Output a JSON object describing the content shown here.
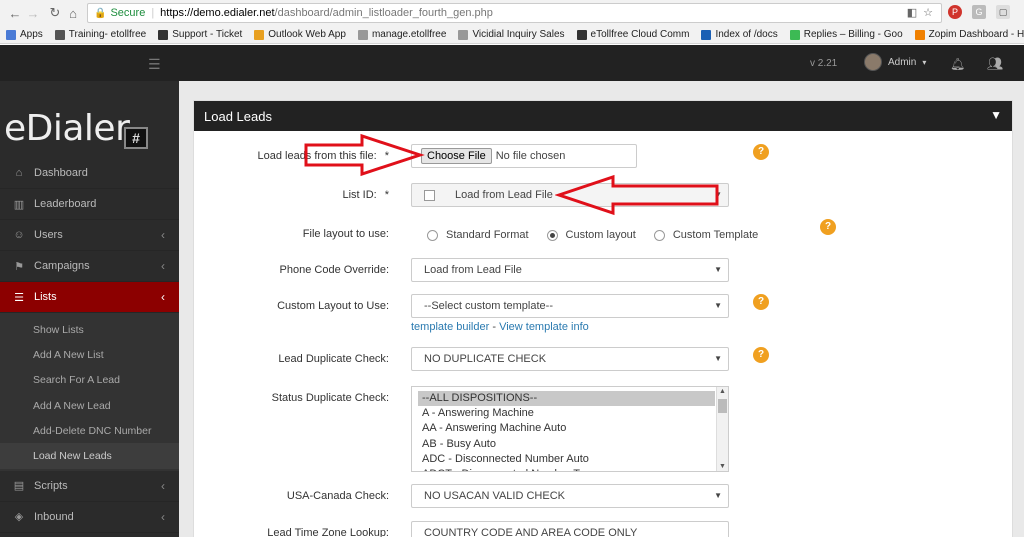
{
  "browser": {
    "secure_label": "Secure",
    "url_host": "https://demo.edialer.net",
    "url_path": "/dashboard/admin_listloader_fourth_gen.php",
    "bookmarks": [
      {
        "label": "Apps",
        "color": "#4a7bd6"
      },
      {
        "label": "Training- etollfree",
        "color": "#555555"
      },
      {
        "label": "Support - Ticket",
        "color": "#333333"
      },
      {
        "label": "Outlook Web App",
        "color": "#e8a020"
      },
      {
        "label": "manage.etollfree",
        "color": "#999999"
      },
      {
        "label": "Vicidial Inquiry Sales",
        "color": "#999999"
      },
      {
        "label": "eTollfree Cloud Comm",
        "color": "#333333"
      },
      {
        "label": "Index of /docs",
        "color": "#1a5fb4"
      },
      {
        "label": "Replies – Billing - Goo",
        "color": "#3cba54"
      },
      {
        "label": "Zopim Dashboard - H",
        "color": "#f08000"
      }
    ]
  },
  "header": {
    "version": "v 2.21",
    "user": "Admin"
  },
  "sidebar": {
    "logo_text": "eDialer",
    "logo_mark": "#",
    "items_top": [
      {
        "label": "Dashboard",
        "icon": "⌂",
        "chev": ""
      },
      {
        "label": "Leaderboard",
        "icon": "▥",
        "chev": ""
      },
      {
        "label": "Users",
        "icon": "☺",
        "chev": "‹"
      },
      {
        "label": "Campaigns",
        "icon": "⚑",
        "chev": "‹"
      },
      {
        "label": "Lists",
        "icon": "☰",
        "chev": "‹"
      }
    ],
    "sub_items": [
      "Show Lists",
      "Add A New List",
      "Search For A Lead",
      "Add A New Lead",
      "Add-Delete DNC Number",
      "Load New Leads"
    ],
    "items_bottom": [
      {
        "label": "Scripts",
        "icon": "▤",
        "chev": "‹"
      },
      {
        "label": "Inbound",
        "icon": "◈",
        "chev": "‹"
      }
    ]
  },
  "panel": {
    "title": "Load Leads",
    "load_file": {
      "label": "Load leads from this file:",
      "required": "*",
      "button": "Choose File",
      "status": "No file chosen"
    },
    "list_id": {
      "label": "List ID:",
      "required": "*",
      "value": "Load from Lead File"
    },
    "file_layout": {
      "label": "File layout to use:",
      "options": [
        "Standard Format",
        "Custom layout",
        "Custom Template"
      ],
      "selected": "Custom layout"
    },
    "phone_code": {
      "label": "Phone Code Override:",
      "value": "Load from Lead File"
    },
    "custom_layout": {
      "label": "Custom Layout to Use:",
      "value": "--Select custom template--",
      "link_builder": "template builder",
      "link_sep": " - ",
      "link_info": "View template info"
    },
    "lead_dup": {
      "label": "Lead Duplicate Check:",
      "value": "NO DUPLICATE CHECK"
    },
    "status_dup": {
      "label": "Status Duplicate Check:",
      "options": [
        "--ALL DISPOSITIONS--",
        "A - Answering Machine",
        "AA - Answering Machine Auto",
        "AB - Busy Auto",
        "ADC - Disconnected Number Auto",
        "ADCT - Disconnected Number Temporary"
      ]
    },
    "usacan": {
      "label": "USA-Canada Check:",
      "value": "NO USACAN VALID CHECK"
    },
    "lead_tz": {
      "label": "Lead Time Zone Lookup:",
      "value": "COUNTRY CODE AND AREA CODE ONLY"
    },
    "help_glyph": "?"
  }
}
